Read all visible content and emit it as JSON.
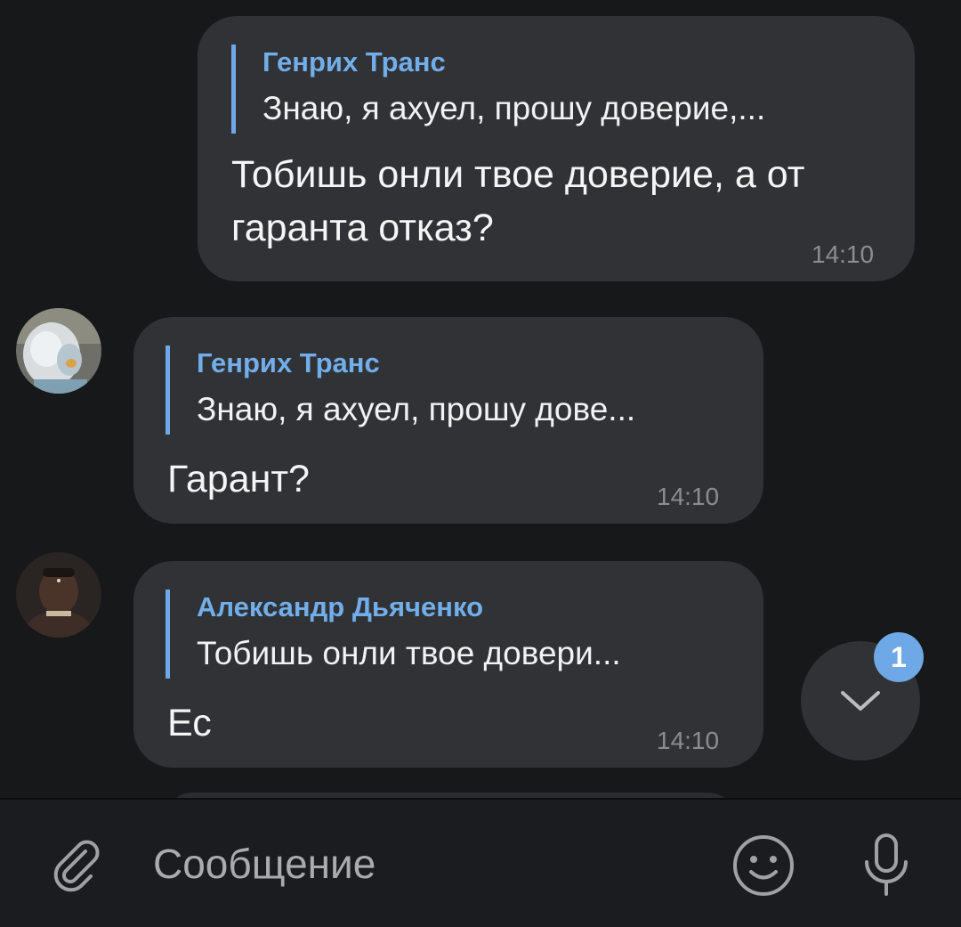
{
  "messages": [
    {
      "reply_name": "Генрих Транс",
      "reply_text": "Знаю, я ахуел, прошу доверие,...",
      "text_line1": "Тобишь онли твое доверие, а от",
      "text_line2": "гаранта отказ?",
      "time": "14:10"
    },
    {
      "reply_name": "Генрих Транс",
      "reply_text": "Знаю, я ахуел, прошу дове...",
      "text": "Гарант?",
      "time": "14:10"
    },
    {
      "reply_name": "Александр Дьяченко",
      "reply_text": "Тобишь онли твое довери...",
      "text": "Ес",
      "time": "14:10"
    }
  ],
  "scroll_down": {
    "unread_count": "1",
    "icon": "chevron-down-icon"
  },
  "input": {
    "placeholder": "Сообщение",
    "attach_icon": "paperclip-icon",
    "emoji_icon": "smile-icon",
    "mic_icon": "microphone-icon"
  },
  "colors": {
    "background": "#17181a",
    "bubble": "#303236",
    "accent": "#6fa8e6",
    "time": "#8a8d92"
  }
}
